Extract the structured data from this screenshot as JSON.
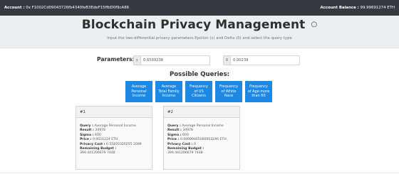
{
  "topbar": {
    "account_label": "Account :",
    "account_value": "0x F1002Cd09043726fb4340feB3EdeF15ffbD0f9cA86",
    "balance_label": "Account Balance :",
    "balance_value": "99.99691274 ETH"
  },
  "header": {
    "title": "Blockchain Privacy Management",
    "title_icon": "shield-icon",
    "subtitle": "Input the two differential privacy parameters Epsilon (ε) and Delta (δ) and select the query type"
  },
  "parameters": {
    "label": "Parameters:",
    "epsilon_symbol": "ε",
    "epsilon_value": "0.6599238",
    "delta_symbol": "δ",
    "delta_value": "0.00239"
  },
  "queries": {
    "title": "Possible Queries:",
    "buttons": [
      "Average\nPersonal\nIncome",
      "Average\nTotal Family\nIncome",
      "Frequency\nof US\nCitizens",
      "Frequency\nof White\nRace",
      "Frequency\nof Age more\nthan 60"
    ],
    "button_color": "#1e88e5"
  },
  "results": [
    {
      "id": "#1",
      "query_label": "Query :",
      "query": "Average Personal Income",
      "result_label": "Result :",
      "result": "34978",
      "sigma_label": "Sigma :",
      "sigma": "600",
      "price_label": "Price :",
      "price": "0.0021224 ETH",
      "privacy_label": "Privacy Cost :",
      "privacy": "0.55870320255 2089",
      "budget_label": "Remaining Budget :",
      "budget": "399.441206679 7448"
    },
    {
      "id": "#2",
      "query_label": "Query :",
      "query": "Average Personal Income",
      "result_label": "Result :",
      "result": "34978",
      "sigma_label": "Sigma :",
      "sigma": "600",
      "price_label": "Price :",
      "price": "0.00089465000003246 ETH",
      "privacy_label": "Privacy Cost :",
      "privacy": "0",
      "budget_label": "Remaining Budget :",
      "budget": "399.441206679 7448"
    }
  ]
}
